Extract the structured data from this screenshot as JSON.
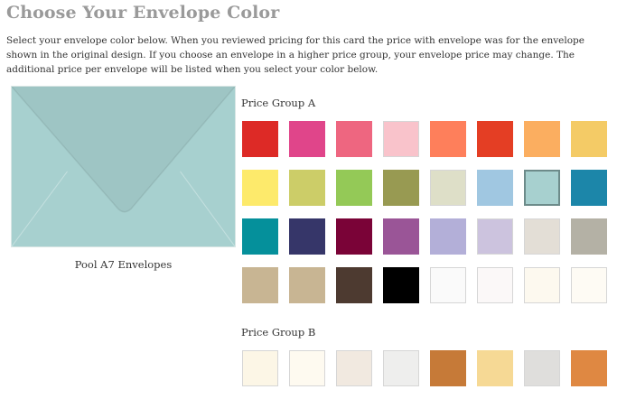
{
  "page": {
    "title": "Choose Your Envelope Color",
    "intro": "Select your envelope color below. When you reviewed pricing for this card the price with envelope was for the envelope shown in the original design. If you choose an envelope in a higher price group, your envelope price may change. The additional price per envelope will be listed when you select your color below."
  },
  "preview": {
    "envelope_color": "#a7d0cf",
    "caption": "Pool A7 Envelopes"
  },
  "groups": [
    {
      "label": "Price Group A",
      "swatches": [
        {
          "color": "#dd2a26"
        },
        {
          "color": "#e0458a"
        },
        {
          "color": "#ee6680"
        },
        {
          "color": "#f9c3cb",
          "light": true
        },
        {
          "color": "#fe7f5b"
        },
        {
          "color": "#e43e24"
        },
        {
          "color": "#fbae60"
        },
        {
          "color": "#f4cb66"
        },
        {
          "color": "#fdea6b"
        },
        {
          "color": "#cccd68"
        },
        {
          "color": "#94c957"
        },
        {
          "color": "#989a52"
        },
        {
          "color": "#dedfc8",
          "light": true
        },
        {
          "color": "#a0c7e1"
        },
        {
          "color": "#a7d0cf",
          "selected": true
        },
        {
          "color": "#1c86a9"
        },
        {
          "color": "#05909b"
        },
        {
          "color": "#363669"
        },
        {
          "color": "#7a0337"
        },
        {
          "color": "#9a5597"
        },
        {
          "color": "#b3afd8"
        },
        {
          "color": "#ccc3de",
          "light": true
        },
        {
          "color": "#e3ded6",
          "light": true
        },
        {
          "color": "#b4b1a5"
        },
        {
          "color": "#c8b593"
        },
        {
          "color": "#c8b593"
        },
        {
          "color": "#4d3a30"
        },
        {
          "color": "#000000"
        },
        {
          "color": "#fafafa",
          "light": true
        },
        {
          "color": "#fbf8f8",
          "light": true
        },
        {
          "color": "#fdf9ef",
          "light": true
        },
        {
          "color": "#fefbf4",
          "light": true
        }
      ]
    },
    {
      "label": "Price Group B",
      "swatches": [
        {
          "color": "#fcf6e6",
          "light": true
        },
        {
          "color": "#fefaf0",
          "light": true
        },
        {
          "color": "#f1e9e0",
          "light": true
        },
        {
          "color": "#eeeeed",
          "light": true
        },
        {
          "color": "#c67a38"
        },
        {
          "color": "#f6d995"
        },
        {
          "color": "#dfdedc",
          "light": true
        },
        {
          "color": "#df8842"
        }
      ]
    }
  ]
}
